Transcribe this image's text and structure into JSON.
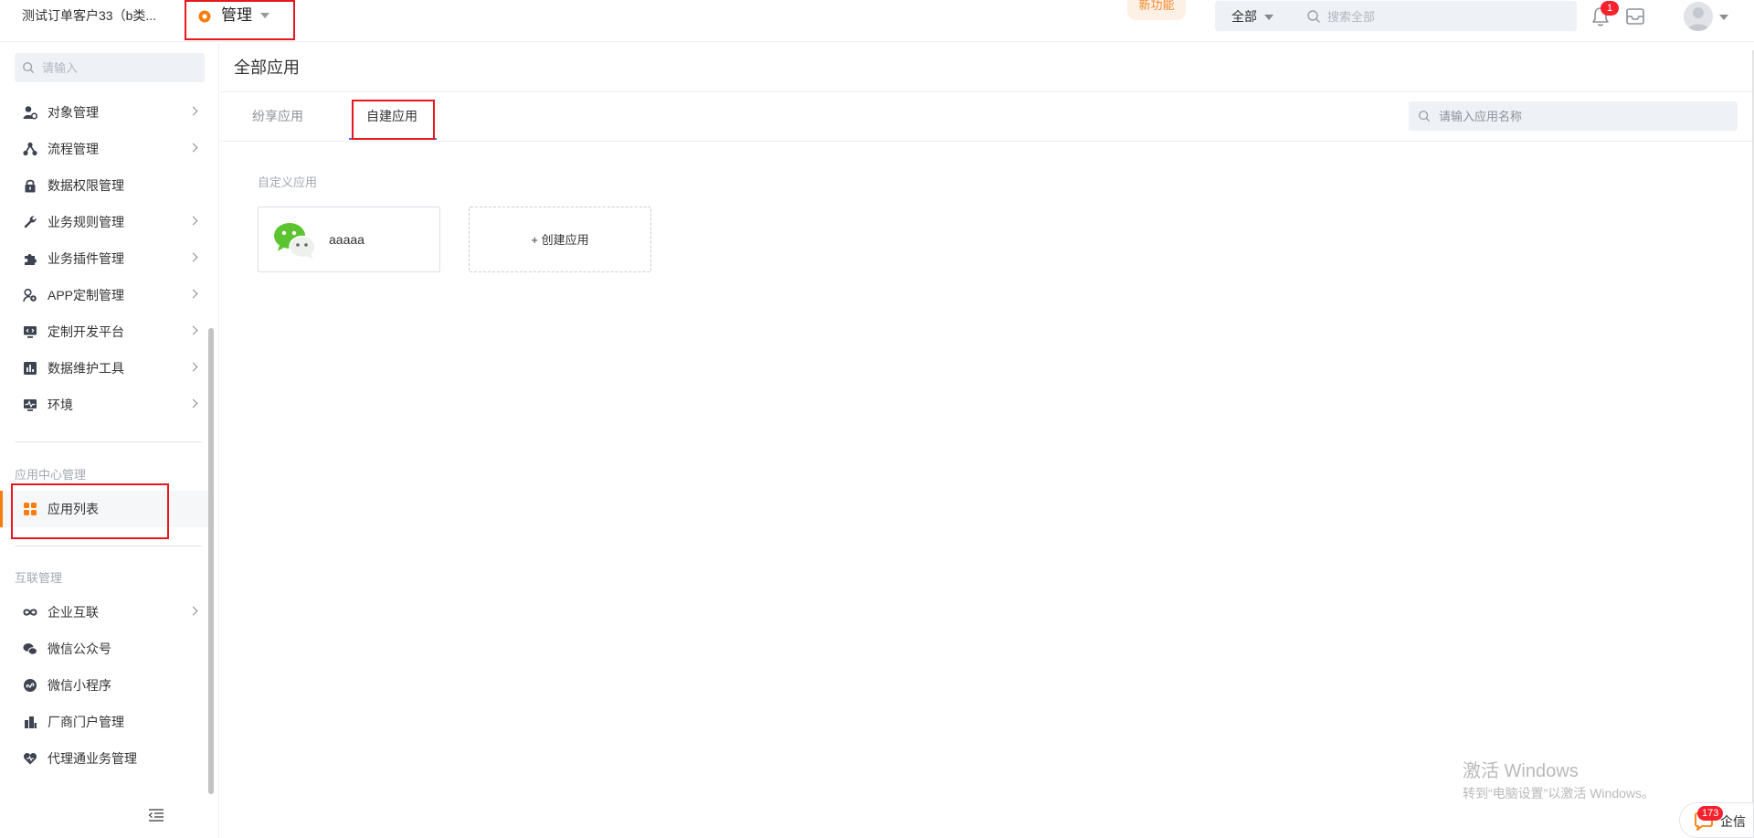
{
  "topbar": {
    "company": "测试订单客户33（b类...",
    "module": "管理",
    "new_feature": "新功能",
    "search_scope": "全部",
    "search_placeholder": "搜索全部",
    "notification_count": "1"
  },
  "sidebar": {
    "search_placeholder": "请输入",
    "items": [
      {
        "label": "对象管理",
        "icon": "object-icon"
      },
      {
        "label": "流程管理",
        "icon": "flow-icon"
      },
      {
        "label": "数据权限管理",
        "icon": "lock-icon"
      },
      {
        "label": "业务规则管理",
        "icon": "wrench-icon"
      },
      {
        "label": "业务插件管理",
        "icon": "puzzle-icon"
      },
      {
        "label": "APP定制管理",
        "icon": "app-gear-icon"
      },
      {
        "label": "定制开发平台",
        "icon": "dev-monitor-icon"
      },
      {
        "label": "数据维护工具",
        "icon": "chart-box-icon"
      },
      {
        "label": "环境",
        "icon": "env-monitor-icon"
      }
    ],
    "group_app_center": "应用中心管理",
    "app_list": "应用列表",
    "group_interconnect": "互联管理",
    "interconnect_items": [
      {
        "label": "企业互联",
        "icon": "infinity-icon"
      },
      {
        "label": "微信公众号",
        "icon": "wechat-icon"
      },
      {
        "label": "微信小程序",
        "icon": "miniprogram-icon"
      },
      {
        "label": "厂商门户管理",
        "icon": "building-icon"
      },
      {
        "label": "代理通业务管理",
        "icon": "heart-icon"
      }
    ]
  },
  "main": {
    "title": "全部应用",
    "tabs": [
      "纷享应用",
      "自建应用"
    ],
    "active_tab": "自建应用",
    "search_placeholder": "请输入应用名称",
    "section_label": "自定义应用",
    "apps": [
      {
        "name": "aaaaa",
        "icon": "wechat-logo"
      }
    ],
    "create_label": "+ 创建应用"
  },
  "watermark": {
    "line1": "激活 Windows",
    "line2": "转到“电脑设置”以激活 Windows。"
  },
  "chat": {
    "badge": "173",
    "label": "企信"
  },
  "colors": {
    "accent_orange": "#f97d0c",
    "tab_active_blue": "#3a6fe0",
    "badge_red": "#f5222d",
    "highlight_red": "#e8171d"
  }
}
